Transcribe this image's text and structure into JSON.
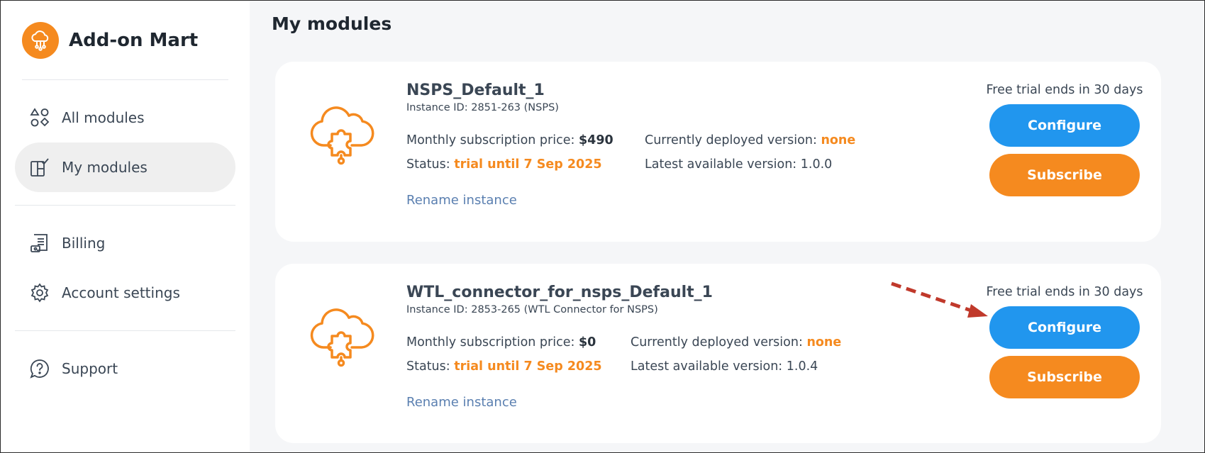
{
  "brand": {
    "name": "Add-on Mart",
    "logo_icon": "cloud-network-icon",
    "accent": "#f58a1f"
  },
  "sidebar": {
    "groups": [
      {
        "items": [
          {
            "label": "All modules",
            "icon": "shapes-icon",
            "active": false
          },
          {
            "label": "My modules",
            "icon": "modules-check-icon",
            "active": true
          }
        ]
      },
      {
        "items": [
          {
            "label": "Billing",
            "icon": "billing-icon",
            "active": false
          },
          {
            "label": "Account settings",
            "icon": "gear-icon",
            "active": false
          }
        ]
      },
      {
        "items": [
          {
            "label": "Support",
            "icon": "help-bubble-icon",
            "active": false
          }
        ]
      }
    ]
  },
  "main": {
    "title": "My modules",
    "cards": [
      {
        "name": "NSPS_Default_1",
        "instance_id": "Instance ID: 2851-263 (NSPS)",
        "price_label": "Monthly subscription price:",
        "price_value": "$490",
        "status_label": "Status:",
        "status_value": "trial until 7 Sep 2025",
        "deployed_label": "Currently deployed version:",
        "deployed_value": "none",
        "latest_label": "Latest available version:",
        "latest_value": "1.0.0",
        "rename": "Rename instance",
        "trial_note": "Free trial ends in 30 days",
        "configure": "Configure",
        "subscribe": "Subscribe",
        "icon": "cloud-puzzle-icon"
      },
      {
        "name": "WTL_connector_for_nsps_Default_1",
        "instance_id": "Instance ID: 2853-265 (WTL Connector for NSPS)",
        "price_label": "Monthly subscription price:",
        "price_value": "$0",
        "status_label": "Status:",
        "status_value": "trial until 7 Sep 2025",
        "deployed_label": "Currently deployed version:",
        "deployed_value": "none",
        "latest_label": "Latest available version:",
        "latest_value": "1.0.4",
        "rename": "Rename instance",
        "trial_note": "Free trial ends in 30 days",
        "configure": "Configure",
        "subscribe": "Subscribe",
        "icon": "cloud-puzzle-icon"
      }
    ]
  },
  "colors": {
    "blue_button": "#2196ee",
    "orange_button": "#f58a1f",
    "annotation_arrow": "#c0392b"
  }
}
